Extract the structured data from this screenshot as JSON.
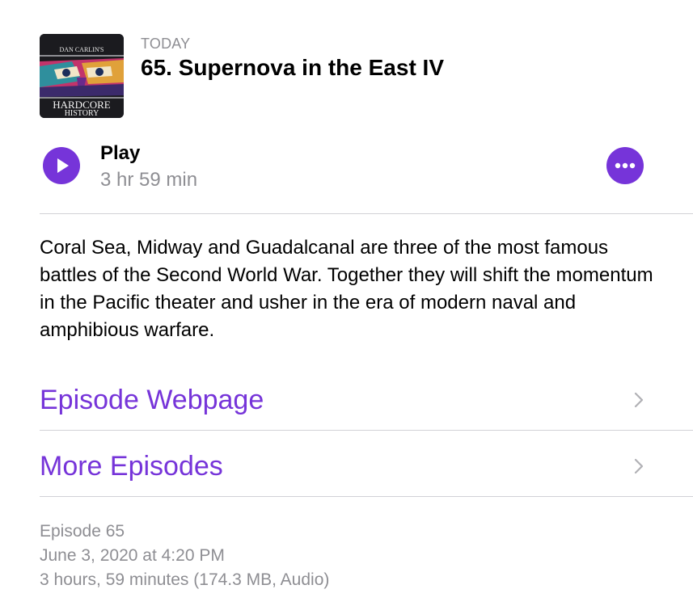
{
  "header": {
    "artwork": {
      "title_top": "DAN CARLIN'S",
      "title_line1": "HARDCORE",
      "title_line2": "HISTORY"
    },
    "date_label": "TODAY",
    "episode_title": "65. Supernova in the East IV"
  },
  "player": {
    "play_label": "Play",
    "duration": "3 hr 59 min",
    "play_icon": "play-icon",
    "more_icon": "ellipsis-icon"
  },
  "description": "Coral Sea, Midway and Guadalcanal are three of the most famous battles of the Second World War. Together they will shift the momentum in the Pacific theater and usher in the era of modern naval and amphibious warfare.",
  "links": [
    {
      "label": "Episode Webpage",
      "icon": "chevron-right-icon"
    },
    {
      "label": "More Episodes",
      "icon": "chevron-right-icon"
    }
  ],
  "info": {
    "episode_number": "Episode 65",
    "published": "June 3, 2020 at 4:20 PM",
    "details": "3 hours, 59 minutes (174.3 MB, Audio)"
  },
  "colors": {
    "accent": "#7634d9",
    "secondary_text": "#8e8e93",
    "separator": "#d1d1d6"
  }
}
